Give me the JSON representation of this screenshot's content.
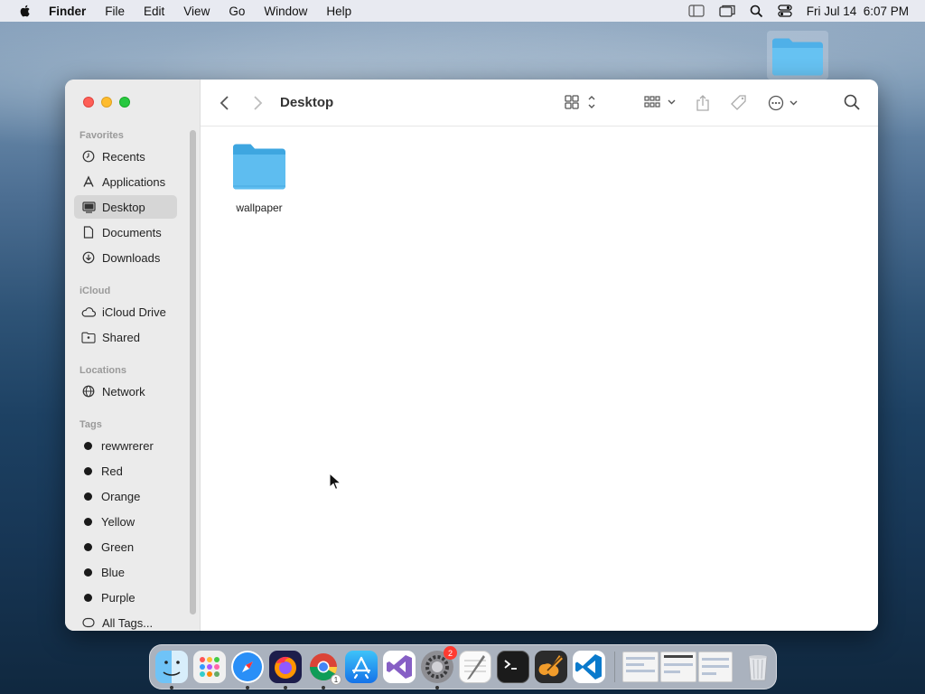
{
  "menubar": {
    "app_name": "Finder",
    "items": [
      "File",
      "Edit",
      "View",
      "Go",
      "Window",
      "Help"
    ],
    "clock": "Fri Jul 14  6:07 PM"
  },
  "window": {
    "title": "Desktop",
    "sidebar": {
      "favorites_header": "Favorites",
      "favorites": [
        {
          "label": "Recents",
          "icon": "clock-icon"
        },
        {
          "label": "Applications",
          "icon": "applications-icon"
        },
        {
          "label": "Desktop",
          "icon": "desktop-icon",
          "selected": true
        },
        {
          "label": "Documents",
          "icon": "document-icon"
        },
        {
          "label": "Downloads",
          "icon": "download-icon"
        }
      ],
      "icloud_header": "iCloud",
      "icloud": [
        {
          "label": "iCloud Drive",
          "icon": "cloud-icon"
        },
        {
          "label": "Shared",
          "icon": "shared-folder-icon"
        }
      ],
      "locations_header": "Locations",
      "locations": [
        {
          "label": "Network",
          "icon": "globe-icon"
        }
      ],
      "tags_header": "Tags",
      "tags": [
        "rewwrerer",
        "Red",
        "Orange",
        "Yellow",
        "Green",
        "Blue",
        "Purple"
      ],
      "all_tags": "All Tags..."
    },
    "files": [
      {
        "name": "wallpaper",
        "icon": "folder-icon"
      }
    ]
  },
  "dock": {
    "apps": [
      "Finder",
      "Launchpad",
      "Safari",
      "Firefox",
      "Chrome",
      "App Store",
      "Visual Studio",
      "System Settings",
      "TextEdit",
      "Terminal",
      "GarageBand",
      "VS Code"
    ],
    "settings_badge": "2",
    "chrome_badge": "1"
  },
  "colors": {
    "accent_folder": "#5ab8ec",
    "close": "#fe5f57",
    "minimize": "#febc2e",
    "maximize": "#28c840"
  }
}
